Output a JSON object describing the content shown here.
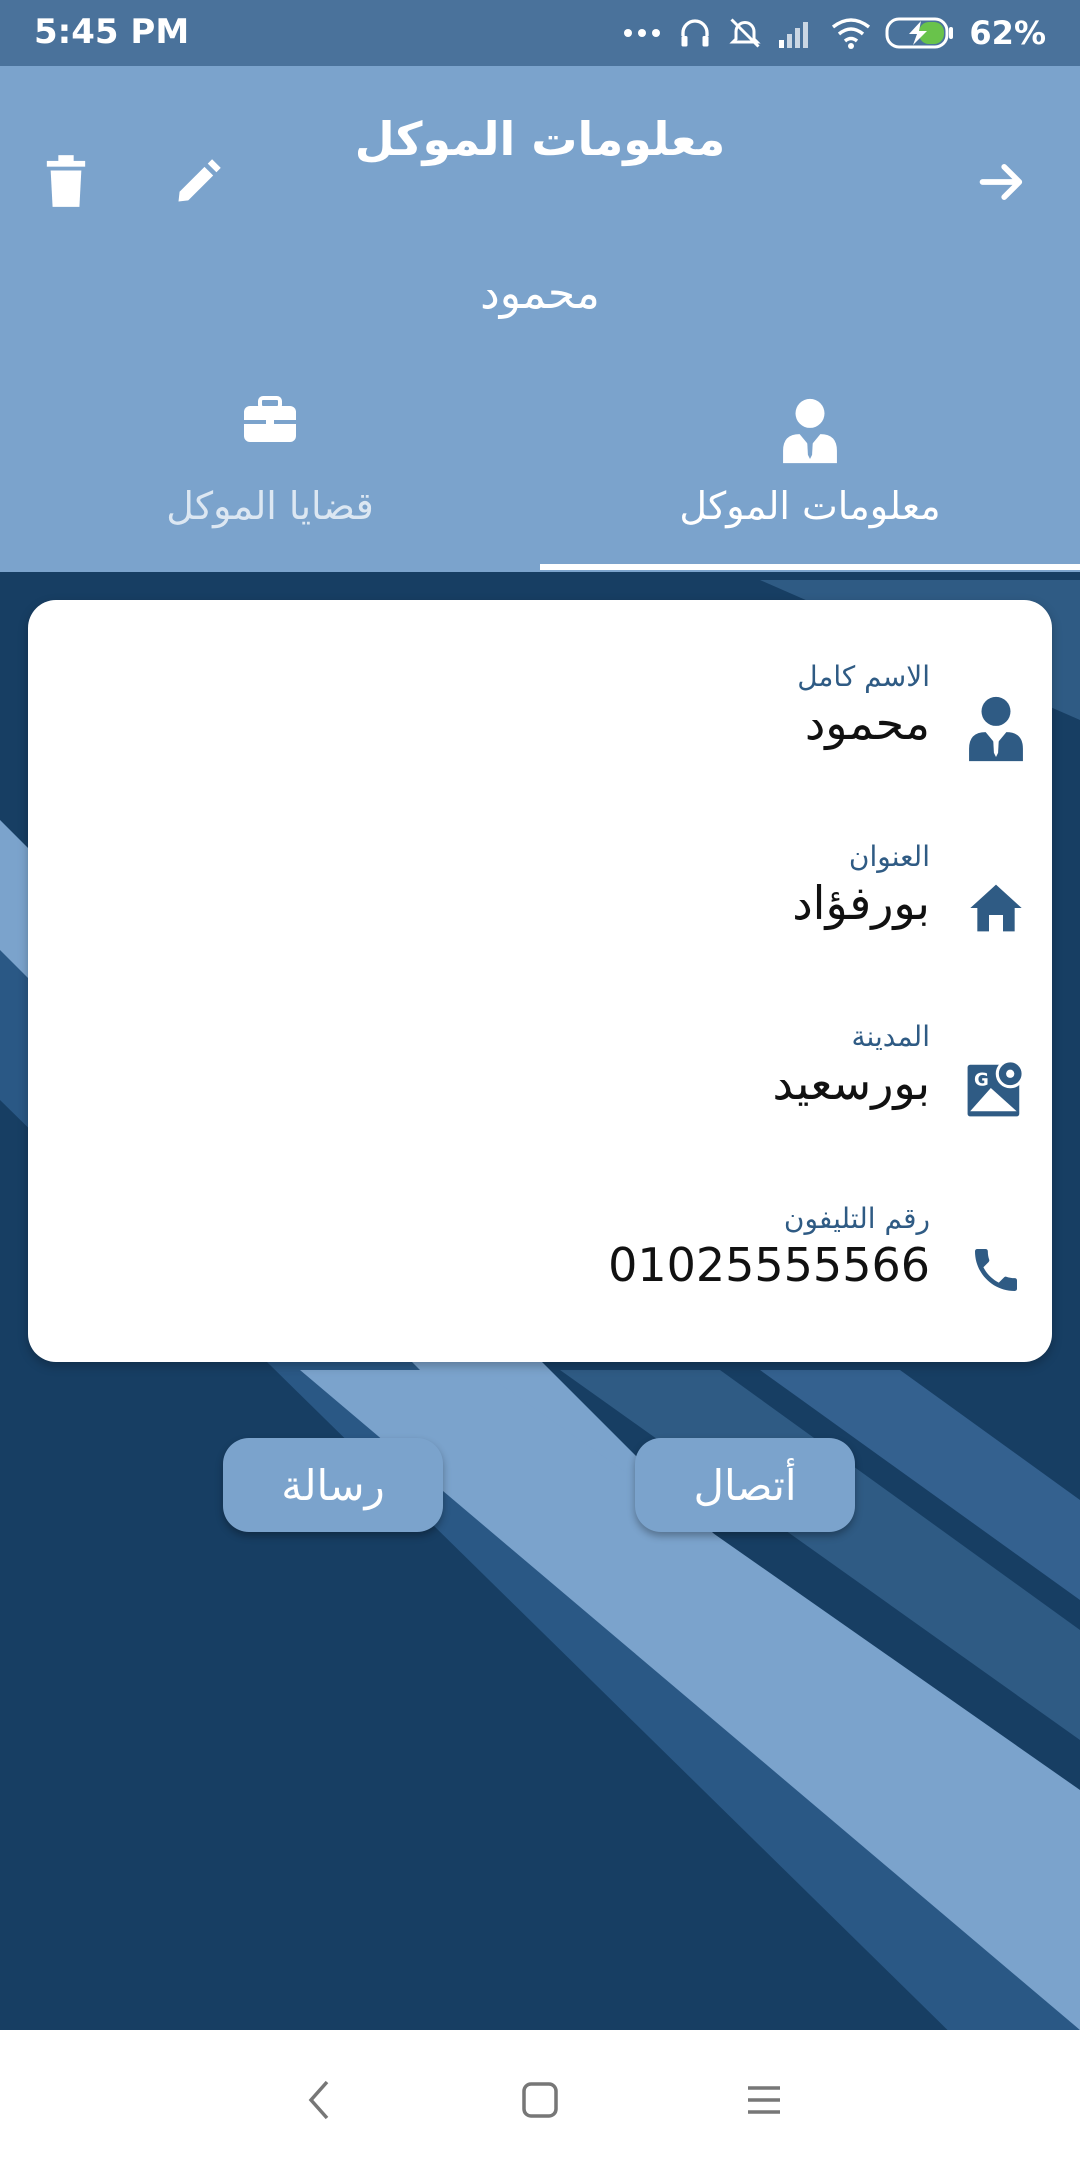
{
  "status_bar": {
    "time": "5:45 PM",
    "battery": "62%"
  },
  "app_bar": {
    "title": "معلومات الموكل",
    "subtitle": "محمود",
    "icons": [
      "delete-icon",
      "edit-icon",
      "arrow-forward-icon"
    ]
  },
  "tabs": [
    {
      "label": "معلومات الموكل",
      "icon": "person-icon",
      "selected": true
    },
    {
      "label": "قضايا الموكل",
      "icon": "briefcase-icon",
      "selected": false
    }
  ],
  "details": {
    "full_name": {
      "label": "الاسم كامل",
      "value": "محمود",
      "icon": "person-icon"
    },
    "address": {
      "label": "العنوان",
      "value": "بورفؤاد",
      "icon": "home-icon"
    },
    "city": {
      "label": "المدينة",
      "value": "بورسعيد",
      "icon": "map-icon"
    },
    "phone": {
      "label": "رقم التليفون",
      "value": "01025555566",
      "icon": "phone-icon"
    }
  },
  "actions": {
    "call_label": "أتصال",
    "message_label": "رسالة"
  },
  "colors": {
    "primary": "#7ba3cc",
    "dark_blue": "#173e63",
    "icon_blue": "#2f5b84",
    "status_bar": "#4a729b"
  }
}
